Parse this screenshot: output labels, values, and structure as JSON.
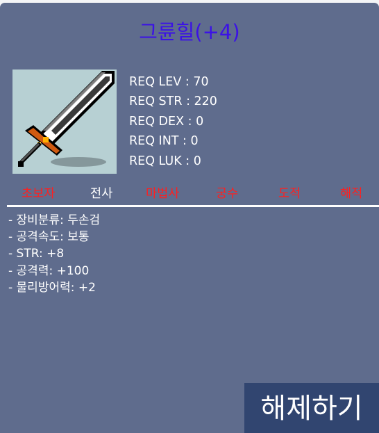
{
  "item": {
    "title": "그륜힐(+4)",
    "icon": "two-handed-sword-icon"
  },
  "requirements": [
    "REQ LEV : 70",
    "REQ STR : 220",
    "REQ DEX : 0",
    "REQ INT : 0",
    "REQ LUK : 0"
  ],
  "jobs": [
    {
      "label": "초보자",
      "allowed": false
    },
    {
      "label": "전사",
      "allowed": true
    },
    {
      "label": "마법사",
      "allowed": false
    },
    {
      "label": "궁수",
      "allowed": false
    },
    {
      "label": "도적",
      "allowed": false
    },
    {
      "label": "해적",
      "allowed": false
    }
  ],
  "stats": [
    "- 장비분류: 두손검",
    "- 공격속도: 보통",
    "- STR: +8",
    "- 공격력: +100",
    "- 물리방어력: +2"
  ],
  "action": {
    "label": "해제하기"
  },
  "colors": {
    "panel": "#5f6c8d",
    "title": "#3b12e6",
    "job_disallowed": "#ff1f1f",
    "job_allowed": "#ffffff",
    "button": "#314570",
    "icon_background": "#b7d0d3"
  }
}
